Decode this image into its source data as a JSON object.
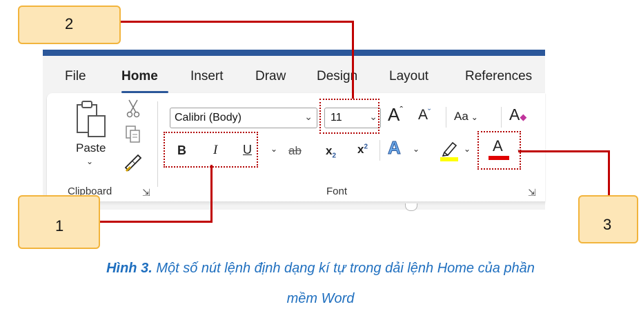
{
  "tabs": [
    "File",
    "Home",
    "Insert",
    "Draw",
    "Design",
    "Layout",
    "References"
  ],
  "active_tab": "Home",
  "clipboard": {
    "paste_label": "Paste",
    "group_label": "Clipboard"
  },
  "font": {
    "font_name": "Calibri (Body)",
    "font_size": "11",
    "grow_label": "A",
    "shrink_label": "A",
    "case_label": "Aa",
    "clear_label": "A",
    "bold_label": "B",
    "italic_label": "I",
    "underline_label": "U",
    "strike_label": "ab",
    "subscript_base": "x",
    "subscript_mark": "2",
    "superscript_base": "x",
    "superscript_mark": "2",
    "effects_label": "A",
    "font_color_label": "A",
    "group_label": "Font",
    "highlight_color": "#ffff00",
    "font_color": "#e00000"
  },
  "callouts": {
    "one": "1",
    "two": "2",
    "three": "3"
  },
  "caption": {
    "prefix": "Hình 3.",
    "line1": " Một số nút lệnh định dạng kí tự trong dải lệnh Home của phần",
    "line2": "mềm Word"
  },
  "colors": {
    "accent": "#2b579a",
    "highlight_box": "#b20000",
    "callout_fill": "#fde6b7",
    "callout_border": "#f2b43c",
    "caption": "#1f6fbf"
  }
}
